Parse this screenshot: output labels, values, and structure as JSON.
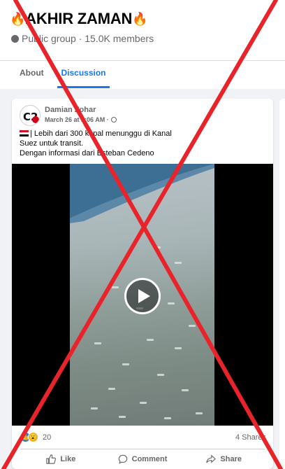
{
  "group": {
    "title": "AKHIR ZAMAN",
    "title_emoji": "🔥",
    "meta": "Public group · 15.0K members"
  },
  "tabs": [
    {
      "label": "About",
      "active": false
    },
    {
      "label": "Discussion",
      "active": true
    }
  ],
  "post": {
    "author": "Damian Zohar",
    "time": "March 26 at 1:06 AM ·",
    "text_lines": [
      "| Lebih dari 300 kapal menunggu di Kanal",
      "Suez untuk transit.",
      "Dengan informasi dari Esteban Cedeno"
    ],
    "reaction_count": "20",
    "shares": "4 Shares"
  },
  "actions": {
    "like": "Like",
    "comment": "Comment",
    "share": "Share"
  },
  "icons": {
    "play": "play-icon",
    "globe": "globe-icon",
    "like": "thumbs-up-icon",
    "comment": "comment-bubble-icon",
    "share": "share-arrow-icon"
  },
  "colors": {
    "accent": "#1877f2",
    "secondary_text": "#65676b",
    "overlay_x": "#e8232a",
    "feed_background": "#f0f2f5"
  }
}
